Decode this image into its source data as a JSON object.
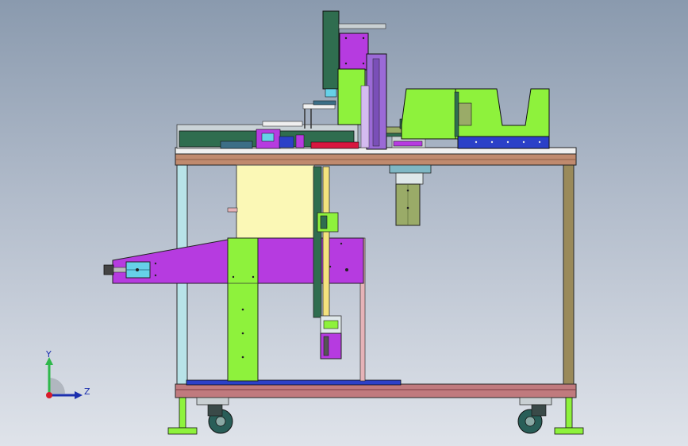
{
  "viewport": {
    "background_top": "#8a9aae",
    "background_bottom": "#dfe3ea"
  },
  "model": {
    "colors": {
      "table_top": "#c08a6e",
      "frame_post": "#b8e3e8",
      "cart_frame": "#c07a7e",
      "magenta_plate": "#b63be0",
      "green_plate": "#8ef23c",
      "light_yellow_block": "#fbf8b6",
      "dark_green": "#2f6d4f",
      "blue_bar": "#2b40c8",
      "olive_column": "#9aab68",
      "violet_column": "#9b6ad7",
      "caster_wheel": "#295e58",
      "red_strip": "#d8163f"
    }
  },
  "triad": {
    "y_label": "Y",
    "z_label": "Z",
    "y_color": "#2fb84b",
    "z_color": "#1b2fae",
    "origin_color": "#d81b2a"
  }
}
